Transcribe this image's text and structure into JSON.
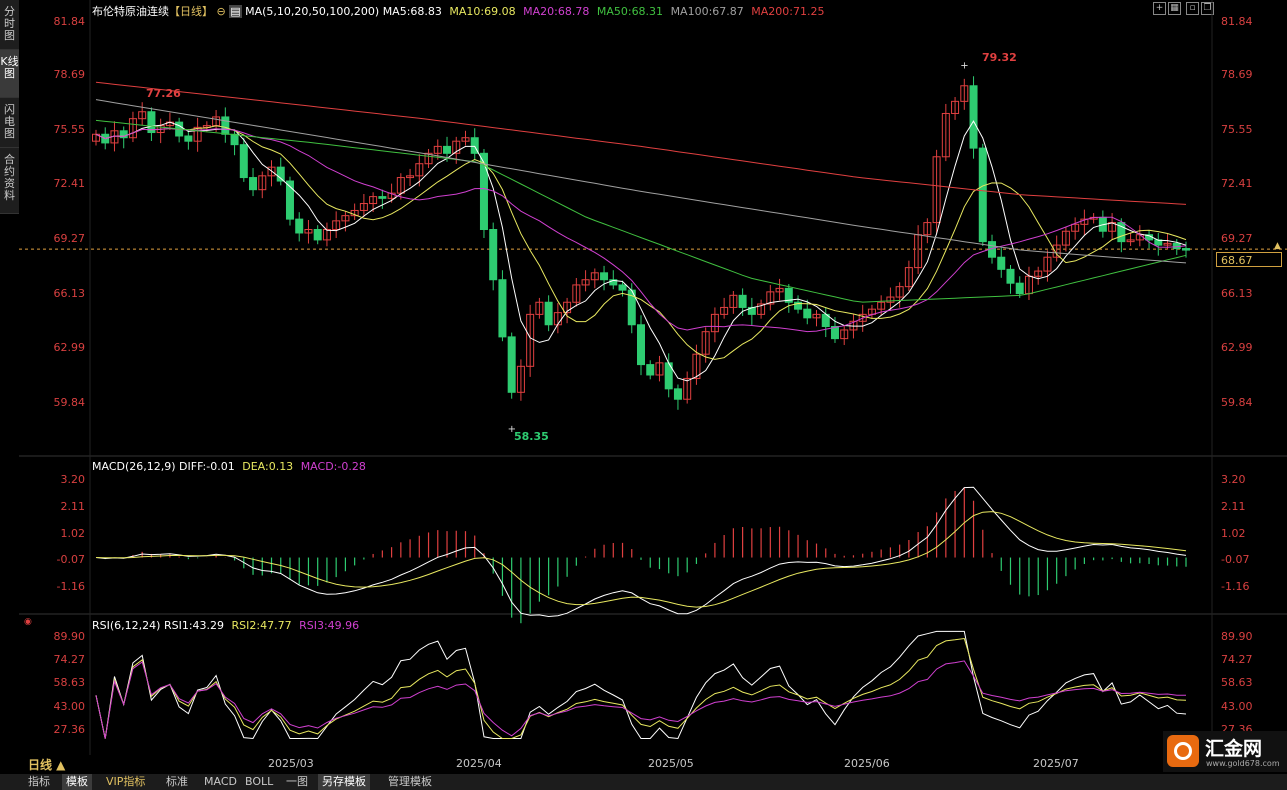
{
  "sidebar": {
    "tabs": [
      {
        "label": "分时图",
        "active": false
      },
      {
        "label": "K线图",
        "active": true
      },
      {
        "label": "闪电图",
        "active": false
      },
      {
        "label": "合约资料",
        "active": false
      }
    ]
  },
  "header": {
    "title": "布伦特原油连续",
    "period": "【日线】",
    "ma_spec": "MA(5,10,20,50,100,200)",
    "ma5": "MA5:68.83",
    "ma10": "MA10:69.08",
    "ma20": "MA20:68.78",
    "ma50": "MA50:68.31",
    "ma100": "MA100:67.87",
    "ma200": "MA200:71.25"
  },
  "colors": {
    "up": "#e04040",
    "down": "#2ecc71",
    "ma5": "#ffffff",
    "ma10": "#e8e860",
    "ma20": "#d040d0",
    "ma50": "#40c040",
    "ma100": "#a0a0a0",
    "ma200": "#e04040"
  },
  "price_axis": {
    "ticks": [
      "81.84",
      "78.69",
      "75.55",
      "72.41",
      "69.27",
      "66.13",
      "62.99",
      "59.84"
    ],
    "current": "68.67"
  },
  "annotations": {
    "high_left": "77.26",
    "high": "79.32",
    "low": "58.35"
  },
  "macd": {
    "title": "MACD(26,12,9)",
    "diff": "DIFF:-0.01",
    "dea": "DEA:0.13",
    "macd": "MACD:-0.28",
    "ticks": [
      "3.20",
      "2.11",
      "1.02",
      "-0.07",
      "-1.16"
    ]
  },
  "rsi": {
    "title": "RSI(6,12,24)",
    "rsi1": "RSI1:43.29",
    "rsi2": "RSI2:47.77",
    "rsi3": "RSI3:49.96",
    "ticks": [
      "89.90",
      "74.27",
      "58.63",
      "43.00",
      "27.36"
    ]
  },
  "dates": [
    "2025/03",
    "2025/04",
    "2025/05",
    "2025/06",
    "2025/07"
  ],
  "period_selector": "日线 ▲",
  "bottom_tabs": [
    "指标",
    "模板",
    "VIP指标",
    "标准",
    "MACD",
    "BOLL",
    "一图",
    "另存模板",
    "管理模板"
  ],
  "logo": {
    "name": "汇金网",
    "url": "www.gold678.com"
  },
  "chart_data": [
    {
      "type": "candlestick",
      "title": "布伦特原油连续【日线】",
      "ylim": [
        58.0,
        82.5
      ],
      "y_ticks": [
        81.84,
        78.69,
        75.55,
        72.41,
        69.27,
        66.13,
        62.99,
        59.84
      ],
      "x_ticks": [
        "2025/03",
        "2025/04",
        "2025/05",
        "2025/06",
        "2025/07"
      ],
      "closes": [
        75.3,
        74.8,
        75.5,
        75.1,
        76.2,
        76.6,
        75.4,
        75.8,
        76.0,
        75.2,
        74.9,
        75.7,
        75.8,
        76.3,
        75.3,
        74.7,
        72.8,
        72.1,
        72.9,
        73.4,
        72.6,
        70.4,
        69.6,
        69.8,
        69.2,
        69.8,
        70.3,
        70.6,
        70.9,
        71.3,
        71.7,
        71.6,
        71.9,
        72.8,
        72.9,
        73.6,
        74.2,
        74.6,
        74.2,
        74.9,
        75.1,
        74.2,
        69.8,
        66.9,
        63.6,
        60.4,
        61.9,
        64.9,
        65.6,
        64.3,
        65.0,
        65.6,
        66.6,
        66.9,
        67.3,
        66.9,
        66.6,
        66.3,
        64.3,
        62.0,
        61.4,
        62.1,
        60.6,
        60.0,
        61.2,
        62.6,
        63.9,
        64.9,
        65.3,
        66.0,
        65.3,
        64.9,
        65.5,
        66.2,
        66.4,
        65.6,
        65.2,
        64.7,
        64.9,
        64.2,
        63.5,
        64.0,
        64.5,
        64.9,
        65.2,
        65.6,
        65.9,
        66.5,
        67.6,
        69.5,
        70.2,
        74.0,
        76.5,
        77.2,
        78.1,
        74.5,
        69.1,
        68.2,
        67.5,
        66.7,
        66.1,
        67.1,
        67.4,
        68.2,
        68.9,
        69.7,
        70.1,
        70.4,
        70.5,
        69.7,
        70.2,
        69.1,
        69.2,
        69.5,
        69.2,
        68.9,
        69.0,
        68.7,
        68.67
      ],
      "high_labels": [
        "77.26",
        "79.32"
      ],
      "low_label": "58.35",
      "series": [
        {
          "name": "MA5",
          "last": 68.83
        },
        {
          "name": "MA10",
          "last": 69.08
        },
        {
          "name": "MA20",
          "last": 68.78
        },
        {
          "name": "MA50",
          "last": 68.31
        },
        {
          "name": "MA100",
          "last": 67.87
        },
        {
          "name": "MA200",
          "last": 71.25
        }
      ]
    },
    {
      "type": "bar",
      "title": "MACD(26,12,9)",
      "ylim": [
        -2.2,
        3.6
      ],
      "y_ticks": [
        3.2,
        2.11,
        1.02,
        -0.07,
        -1.16
      ],
      "series": [
        {
          "name": "DIFF",
          "last": -0.01
        },
        {
          "name": "DEA",
          "last": 0.13
        },
        {
          "name": "MACD",
          "last": -0.28
        }
      ]
    },
    {
      "type": "line",
      "title": "RSI(6,12,24)",
      "ylim": [
        20,
        95
      ],
      "y_ticks": [
        89.9,
        74.27,
        58.63,
        43.0,
        27.36
      ],
      "series": [
        {
          "name": "RSI1",
          "last": 43.29
        },
        {
          "name": "RSI2",
          "last": 47.77
        },
        {
          "name": "RSI3",
          "last": 49.96
        }
      ]
    }
  ]
}
